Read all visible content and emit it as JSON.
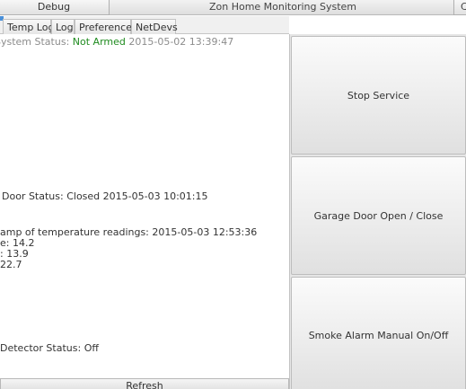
{
  "window": {
    "debug_label": "Debug",
    "title": "Zon Home Monitoring System",
    "close_label": "C"
  },
  "tabs": [
    {
      "label": "Temp Log"
    },
    {
      "label": "Log"
    },
    {
      "label": "Preferences"
    },
    {
      "label": "NetDevs"
    }
  ],
  "status": {
    "system_label": "System Status:",
    "system_value": "Not Armed",
    "system_time": "2015-05-02 13:39:47",
    "door_label": "Door Status:",
    "door_value": "Closed",
    "door_time": "2015-05-03 10:01:15",
    "temp_label": "amp of temperature readings:",
    "temp_time": "2015-05-03 12:53:36",
    "reading_1": "e: 14.2",
    "reading_2": ": 13.9",
    "reading_3": "22.7",
    "detector_label": "Detector Status:",
    "detector_value": "Off"
  },
  "buttons": {
    "refresh": "Refresh",
    "stop_service": "Stop Service",
    "garage": "Garage Door Open / Close",
    "smoke": "Smoke Alarm Manual On/Off"
  },
  "colors": {
    "armed_status": "#1f8b1f",
    "tab_accent": "#4a90d9"
  }
}
